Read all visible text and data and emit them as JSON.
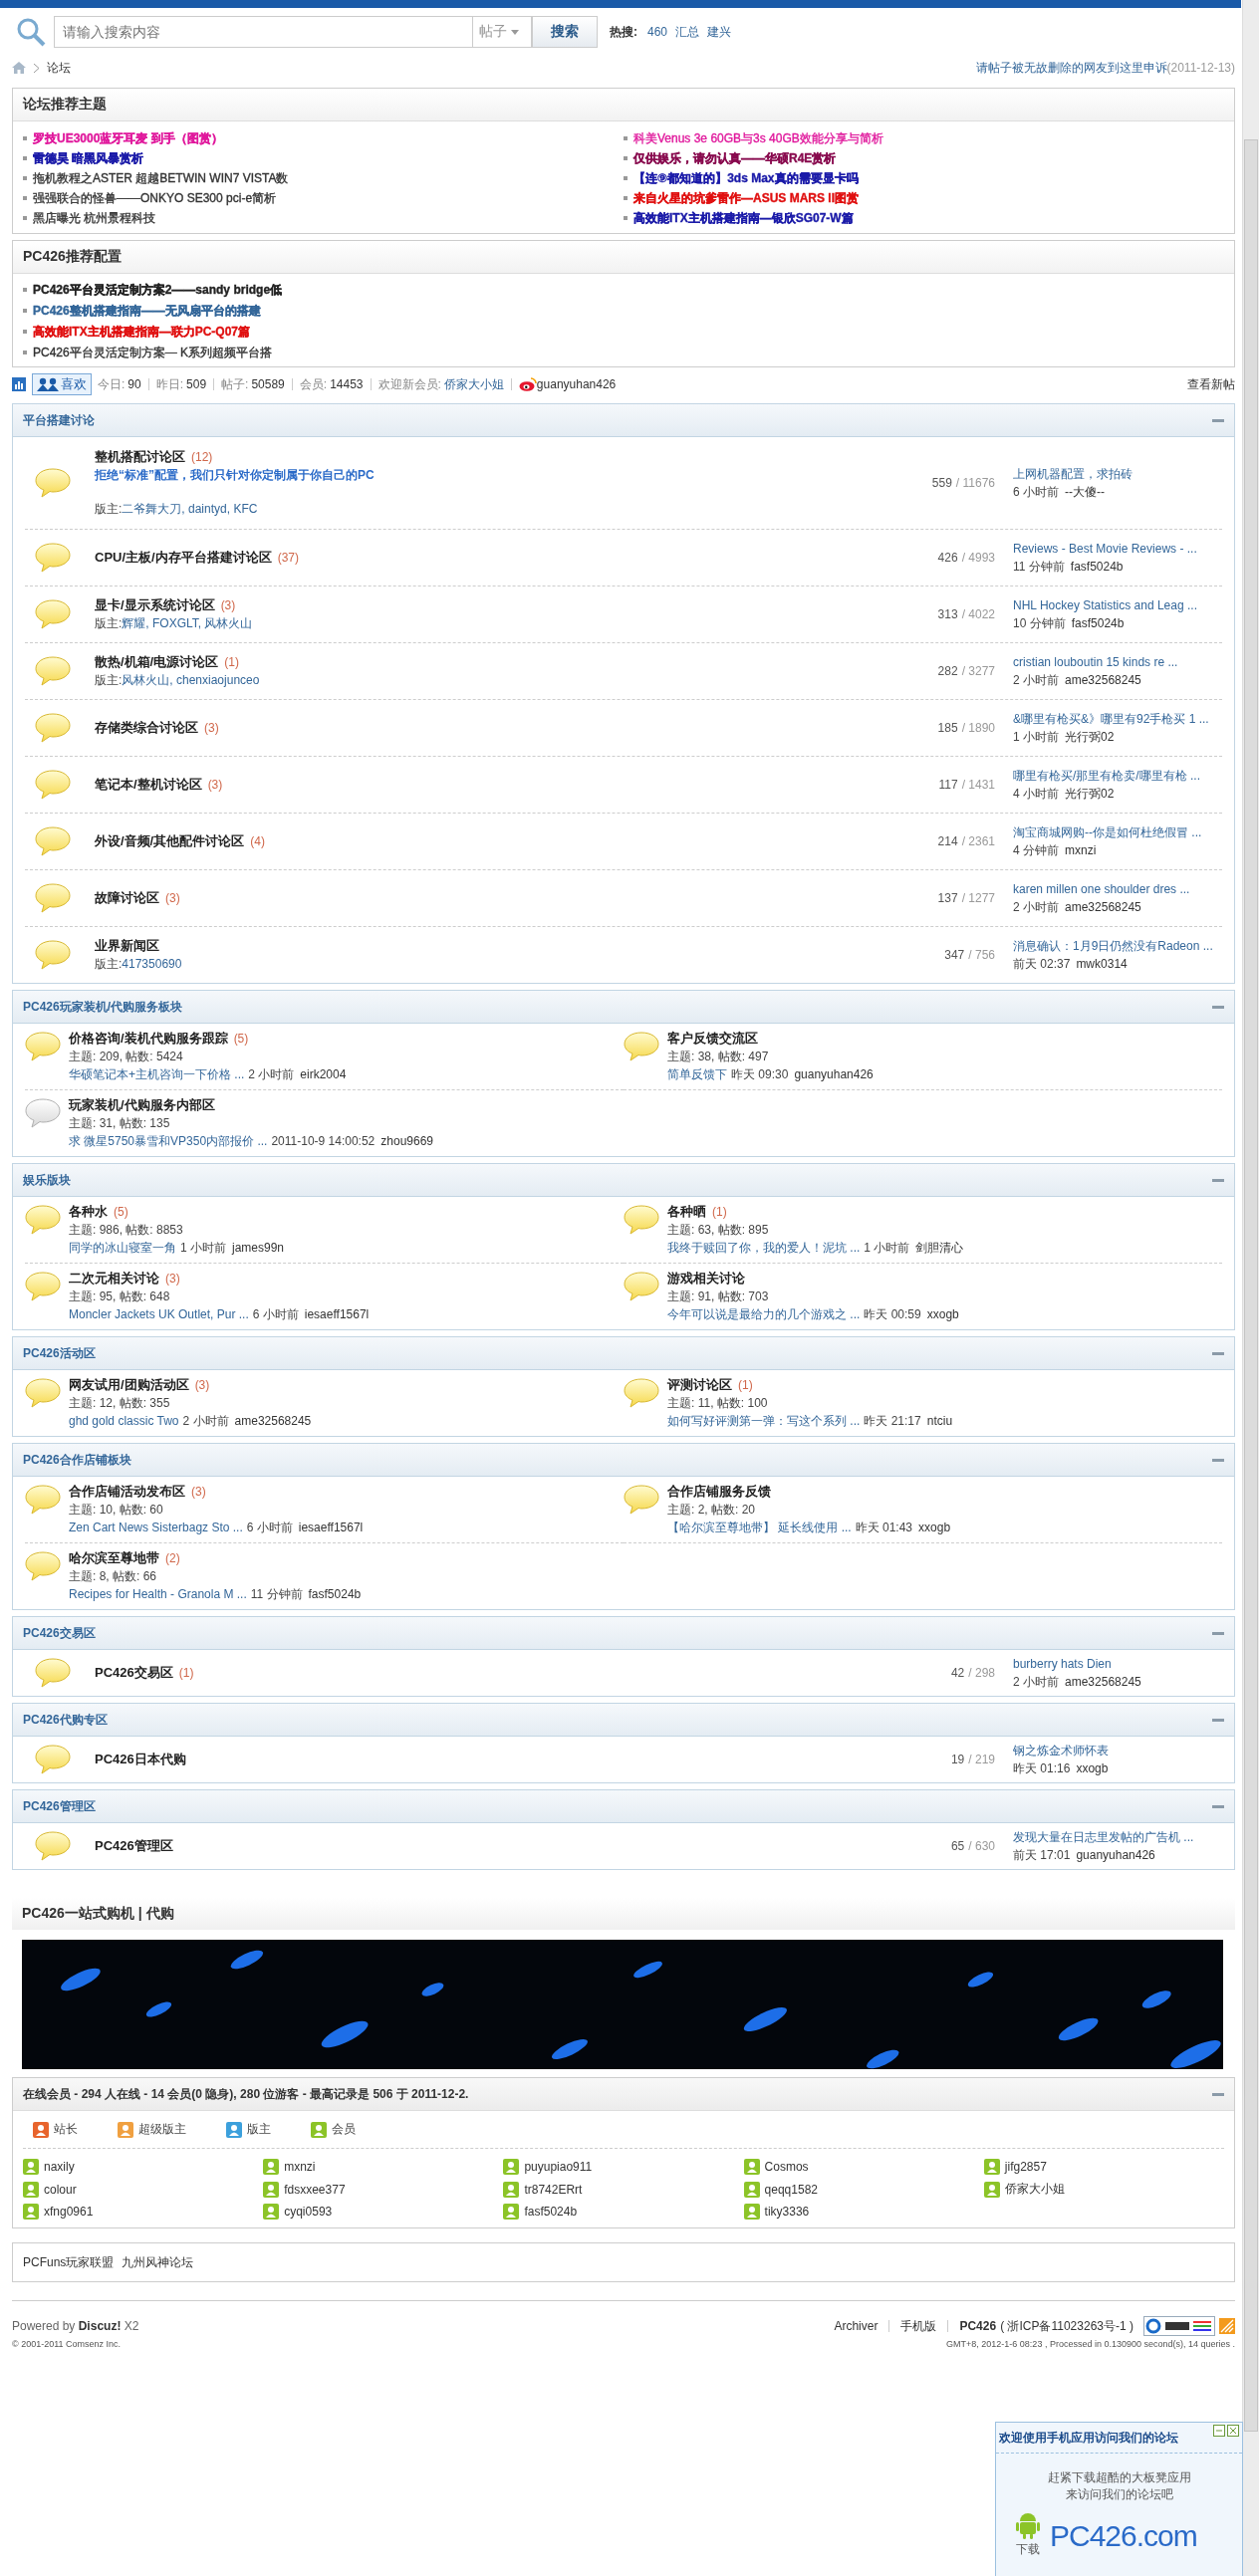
{
  "search": {
    "placeholder": "请输入搜索内容",
    "scope": "帖子",
    "button": "搜索",
    "hot_label": "热搜:",
    "hot_terms": [
      "460",
      "汇总",
      "建兴"
    ]
  },
  "breadcrumb": {
    "items": [
      "论坛"
    ]
  },
  "notice": {
    "text": "请帖子被无故删除的网友到这里申诉",
    "date": "(2011-12-13)"
  },
  "featured_topics": {
    "title": "论坛推荐主题",
    "items": [
      {
        "text": "罗技UE3000蓝牙耳麦 到手（图赏）",
        "color": "#e0189c",
        "bold": true
      },
      {
        "text": "科美Venus 3e 60GB与3s 40GB效能分享与简析",
        "color": "#e0189c",
        "bold": false
      },
      {
        "text": "雷德昊 暗黑风暴赏析",
        "color": "#1a1aa8",
        "bold": true
      },
      {
        "text": "仅供娱乐，请勿认真——华硕R4E赏析",
        "color": "#880a4e",
        "bold": true
      },
      {
        "text": "拖机教程之ASTER 超越BETWIN WIN7 VISTA数",
        "color": "#333333",
        "bold": false
      },
      {
        "text": "【连⑨都知道的】3ds Max真的需要显卡吗",
        "color": "#1a1aa8",
        "bold": true
      },
      {
        "text": "强强联合的怪兽——ONKYO SE300 pci-e简析",
        "color": "#333333",
        "bold": false
      },
      {
        "text": "来自火星的坑爹雷作—ASUS MARS II图赏",
        "color": "#e01010",
        "bold": true
      },
      {
        "text": "黑店曝光 杭州景程科技",
        "color": "#333333",
        "bold": false
      },
      {
        "text": "高效能ITX主机搭建指南—银欣SG07-W篇",
        "color": "#1a1aa8",
        "bold": true
      }
    ]
  },
  "recommended_configs": {
    "title": "PC426推荐配置",
    "items": [
      {
        "text": "PC426平台灵活定制方案2——sandy bridge低",
        "color": "#222222",
        "bold": true
      },
      {
        "text": "PC426整机搭建指南——无风扇平台的搭建",
        "color": "#336699",
        "bold": true
      },
      {
        "text": "高效能ITX主机搭建指南—联力PC-Q07篇",
        "color": "#e01010",
        "bold": true
      },
      {
        "text": "PC426平台灵活定制方案— K系列超频平台搭",
        "color": "#333333",
        "bold": false
      }
    ]
  },
  "stats": {
    "like_button": "喜欢",
    "items": [
      {
        "label": "今日:",
        "value": "90"
      },
      {
        "label": "昨日:",
        "value": "509"
      },
      {
        "label": "帖子:",
        "value": "50589"
      },
      {
        "label": "会员:",
        "value": "14453"
      }
    ],
    "newest_label": "欢迎新会员:",
    "newest_member": "侨家大小姐",
    "weibo": "guanyuhan426",
    "new_posts_link": "查看新帖"
  },
  "categories": [
    {
      "title": "平台搭建讨论",
      "kind": "list",
      "forums": [
        {
          "name": "整机搭配讨论区",
          "today": "(12)",
          "description": "拒绝“标准”配置，我们只针对你定制属于你自己的PC",
          "moderators_label": "版主:",
          "moderators": "二爷舞大刀, daintyd, KFC",
          "threads": "559",
          "posts": "/ 11676",
          "last_title": "上网机器配置，求拍砖",
          "last_time": "6 小时前",
          "last_author": "--大傻--",
          "has_new": true
        },
        {
          "name": "CPU/主板/内存平台搭建讨论区",
          "today": "(37)",
          "threads": "426",
          "posts": "/ 4993",
          "last_title": "Reviews - Best Movie Reviews - ...",
          "last_time": "11 分钟前",
          "last_author": "fasf5024b",
          "has_new": true
        },
        {
          "name": "显卡/显示系统讨论区",
          "today": "(3)",
          "moderators_label": "版主:",
          "moderators": "辉耀, FOXGLT, 风林火山",
          "threads": "313",
          "posts": "/ 4022",
          "last_title": "NHL Hockey Statistics and Leag ...",
          "last_time": "10 分钟前",
          "last_author": "fasf5024b",
          "has_new": true
        },
        {
          "name": "散热/机箱/电源讨论区",
          "today": "(1)",
          "moderators_label": "版主:",
          "moderators": "风林火山, chenxiaojunceo",
          "threads": "282",
          "posts": "/ 3277",
          "last_title": "cristian louboutin 15 kinds re ...",
          "last_time": "2 小时前",
          "last_author": "ame32568245",
          "has_new": true
        },
        {
          "name": "存储类综合讨论区",
          "today": "(3)",
          "threads": "185",
          "posts": "/ 1890",
          "last_title": "&哪里有枪买&》哪里有92手枪买 1 ...",
          "last_time": "1 小时前",
          "last_author": "光行弼02",
          "has_new": true
        },
        {
          "name": "笔记本/整机讨论区",
          "today": "(3)",
          "threads": "117",
          "posts": "/ 1431",
          "last_title": "哪里有枪买/那里有枪卖/哪里有枪 ...",
          "last_time": "4 小时前",
          "last_author": "光行弼02",
          "has_new": true
        },
        {
          "name": "外设/音频/其他配件讨论区",
          "today": "(4)",
          "threads": "214",
          "posts": "/ 2361",
          "last_title": "淘宝商城网购--你是如何杜绝假冒 ...",
          "last_time": "4 分钟前",
          "last_author": "mxnzi",
          "has_new": true
        },
        {
          "name": "故障讨论区",
          "today": "(3)",
          "threads": "137",
          "posts": "/ 1277",
          "last_title": "karen millen one shoulder dres ...",
          "last_time": "2 小时前",
          "last_author": "ame32568245",
          "has_new": true
        },
        {
          "name": "业界新闻区",
          "moderators_label": "版主:",
          "moderators": "417350690",
          "threads": "347",
          "posts": "/ 756",
          "last_title": "消息确认：1月9日仍然没有Radeon ...",
          "last_time": "前天 02:37",
          "last_author": "mwk0314",
          "has_new": true
        }
      ]
    },
    {
      "title": "PC426玩家装机/代购服务板块",
      "kind": "grid",
      "forums": [
        {
          "name": "价格咨询/装机代购服务跟踪",
          "today": "(5)",
          "stats": "主题: 209, 帖数: 5424",
          "last_title": "华硕笔记本+主机咨询一下价格 ...",
          "last_time": "2 小时前",
          "last_author": "eirk2004",
          "has_new": true
        },
        {
          "name": "客户反馈交流区",
          "stats": "主题: 38, 帖数: 497",
          "last_title": "简单反馈下",
          "last_time": "昨天 09:30",
          "last_author": "guanyuhan426",
          "has_new": true
        },
        {
          "name": "玩家装机/代购服务内部区",
          "stats": "主题: 31, 帖数: 135",
          "last_title": "求 微星5750暴雪和VP350内部报价 ...",
          "last_time": "2011-10-9 14:00:52",
          "last_author": "zhou9669",
          "has_new": false
        }
      ]
    },
    {
      "title": "娱乐版块",
      "kind": "grid",
      "forums": [
        {
          "name": "各种水",
          "today": "(5)",
          "stats": "主题: 986, 帖数: 8853",
          "last_title": "同学的冰山寝室一角",
          "last_time": "1 小时前",
          "last_author": "james99n",
          "has_new": true
        },
        {
          "name": "各种晒",
          "today": "(1)",
          "stats": "主题: 63, 帖数: 895",
          "last_title": "我终于赎回了你，我的爱人！泥坑 ...",
          "last_time": "1 小时前",
          "last_author": "剑胆清心",
          "has_new": true
        },
        {
          "name": "二次元相关讨论",
          "today": "(3)",
          "stats": "主题: 95, 帖数: 648",
          "last_title": "Moncler Jackets UK Outlet, Pur ...",
          "last_time": "6 小时前",
          "last_author": "iesaeff1567l",
          "has_new": true
        },
        {
          "name": "游戏相关讨论",
          "stats": "主题: 91, 帖数: 703",
          "last_title": "今年可以说是最给力的几个游戏之 ...",
          "last_time": "昨天 00:59",
          "last_author": "xxogb",
          "has_new": true
        }
      ]
    },
    {
      "title": "PC426活动区",
      "kind": "grid",
      "forums": [
        {
          "name": "网友试用/团购活动区",
          "today": "(3)",
          "stats": "主题: 12, 帖数: 355",
          "last_title": "ghd gold classic Two",
          "last_time": "2 小时前",
          "last_author": "ame32568245",
          "has_new": true
        },
        {
          "name": "评测讨论区",
          "today": "(1)",
          "stats": "主题: 11, 帖数: 100",
          "last_title": "如何写好评测第一弹：写这个系列 ...",
          "last_time": "昨天 21:17",
          "last_author": "ntciu",
          "has_new": true
        }
      ]
    },
    {
      "title": "PC426合作店铺板块",
      "kind": "grid",
      "forums": [
        {
          "name": "合作店铺活动发布区",
          "today": "(3)",
          "stats": "主题: 10, 帖数: 60",
          "last_title": "Zen Cart News Sisterbagz Sto ...",
          "last_time": "6 小时前",
          "last_author": "iesaeff1567l",
          "has_new": true
        },
        {
          "name": "合作店铺服务反馈",
          "stats": "主题: 2, 帖数: 20",
          "last_title": "【哈尔滨至尊地带】 延长线使用 ...",
          "last_time": "昨天 01:43",
          "last_author": "xxogb",
          "has_new": true
        },
        {
          "name": "哈尔滨至尊地带",
          "today": "(2)",
          "stats": "主题: 8, 帖数: 66",
          "last_title": "Recipes for Health - Granola M ...",
          "last_time": "11 分钟前",
          "last_author": "fasf5024b",
          "has_new": true
        }
      ]
    },
    {
      "title": "PC426交易区",
      "kind": "list",
      "forums": [
        {
          "name": "PC426交易区",
          "today": "(1)",
          "threads": "42",
          "posts": "/ 298",
          "last_title": "burberry hats Dien",
          "last_time": "2 小时前",
          "last_author": "ame32568245",
          "has_new": true
        }
      ]
    },
    {
      "title": "PC426代购专区",
      "kind": "list",
      "forums": [
        {
          "name": "PC426日本代购",
          "threads": "19",
          "posts": "/ 219",
          "last_title": "钢之炼金术师怀表",
          "last_time": "昨天 01:16",
          "last_author": "xxogb",
          "has_new": true
        }
      ]
    },
    {
      "title": "PC426管理区",
      "kind": "list",
      "forums": [
        {
          "name": "PC426管理区",
          "threads": "65",
          "posts": "/ 630",
          "last_title": "发现大量在日志里发帖的广告机 ...",
          "last_time": "前天 17:01",
          "last_author": "guanyuhan426",
          "has_new": true
        }
      ]
    }
  ],
  "banner": {
    "title": "PC426一站式购机 | 代购",
    "kind": "picture"
  },
  "online": {
    "title": "在线会员 - 294 人在线 - 14 会员(0 隐身), 280 位游客 - 最高记录是 506 于 2011-12-2.",
    "legend": [
      {
        "label": "站长",
        "color": "#e8642c"
      },
      {
        "label": "超级版主",
        "color": "#f0a040"
      },
      {
        "label": "版主",
        "color": "#3ca0dc"
      },
      {
        "label": "会员",
        "color": "#8cc428"
      }
    ],
    "members": [
      "naxily",
      "mxnzi",
      "puyupiao911",
      "Cosmos",
      "jifg2857",
      "colour",
      "fdsxxee377",
      "tr8742ERrt",
      "qeqq1582",
      "侨家大小姐",
      "xfng0961",
      "cyqi0593",
      "fasf5024b",
      "tiky3336"
    ]
  },
  "friend_links": [
    "PCFuns玩家联盟",
    "九州风神论坛"
  ],
  "footer": {
    "powered": "Powered by **Discuz!** X2",
    "copyright": "© 2001-2011 Comsenz Inc.",
    "links": [
      "Archiver",
      "手机版"
    ],
    "site": "PC426",
    "icp": "( 浙ICP备11023263号-1 )",
    "info": "GMT+8, 2012-1-6 08:23 , Processed in 0.130900 second(s), 14 queries ."
  },
  "app_popup": {
    "title": "欢迎使用手机应用访问我们的论坛",
    "lines": [
      "赶紧下载超酷的大板凳应用",
      "来访问我们的论坛吧"
    ],
    "download": "下载",
    "logo": "PC426.com"
  }
}
